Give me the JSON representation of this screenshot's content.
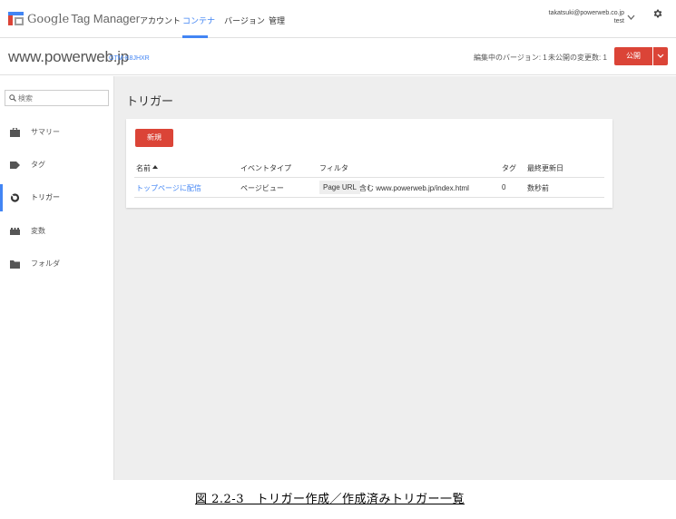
{
  "app": {
    "brand_google": "Google",
    "brand_product": "Tag Manager",
    "logo_colors": [
      "#4285f4",
      "#db4437",
      "#f4b400",
      "#0f9d58"
    ]
  },
  "nav": {
    "items": [
      {
        "label": "アカウント",
        "active": false
      },
      {
        "label": "コンテナ",
        "active": true
      },
      {
        "label": "バージョン",
        "active": false
      },
      {
        "label": "管理",
        "active": false
      }
    ]
  },
  "account": {
    "email": "takatsuki@powerweb.co.jp",
    "name": "test",
    "chevron_icon": "chevron-down-icon",
    "settings_icon": "gear-icon"
  },
  "container": {
    "name": "www.powerweb.jp",
    "id": "GTM-K8JHXR",
    "workspace_version": "編集中のバージョン: 1",
    "unpublished_changes": "未公開の変更数: 1",
    "publish_label": "公開"
  },
  "sidebar": {
    "search_placeholder": "検索",
    "items": [
      {
        "label": "サマリー",
        "icon": "briefcase-icon",
        "active": false
      },
      {
        "label": "タグ",
        "icon": "tag-icon",
        "active": false
      },
      {
        "label": "トリガー",
        "icon": "trigger-icon",
        "active": true
      },
      {
        "label": "変数",
        "icon": "variables-icon",
        "active": false
      },
      {
        "label": "フォルダ",
        "icon": "folder-icon",
        "active": false
      }
    ]
  },
  "main": {
    "title": "トリガー",
    "new_label": "新規",
    "columns": [
      "名前",
      "イベントタイプ",
      "フィルタ",
      "タグ",
      "最終更新日"
    ],
    "rows": [
      {
        "name": "トップページに配信",
        "event_type": "ページビュー",
        "filter_variable": "Page URL",
        "filter_condition": "含む www.powerweb.jp/index.html",
        "tags": "0",
        "last_updated": "数秒前"
      }
    ]
  },
  "caption": "図 2.2-3　トリガー作成／作成済みトリガー一覧",
  "colors": {
    "accent": "#4285f4",
    "primary_button": "#db4437",
    "main_background": "#eeeeee"
  }
}
